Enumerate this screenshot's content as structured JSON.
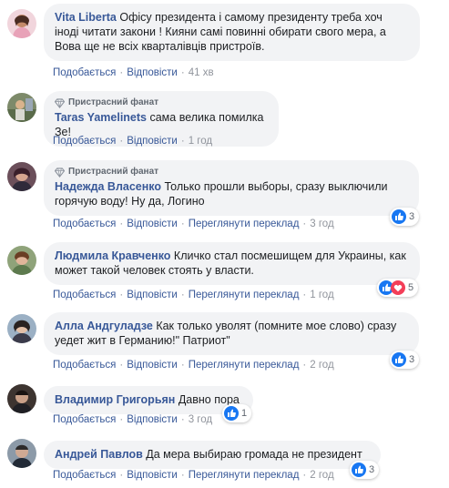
{
  "fan_badge": "Пристрасний фанат",
  "actions": {
    "like": "Подобається",
    "reply": "Відповісти",
    "see_translation": "Переглянути переклад"
  },
  "comments": [
    {
      "author": "Vita Liberta",
      "text": "Офісу президента і самому президенту треба хоч іноді читати закони ! Кияни самі повинні обирати свого мера, а Вова ще не всіх кварталівців пристроїв.",
      "time": "41 хв",
      "fan": false,
      "translate": false,
      "reactions": null
    },
    {
      "author": "Taras Yamelinets",
      "text": "сама велика помилка Зе!",
      "time": "1 год",
      "fan": true,
      "translate": false,
      "reactions": null
    },
    {
      "author": "Надежда Власенко",
      "text": "Только прошли выборы, сразу выключили горячую воду! Ну да, Логино",
      "time": "3 год",
      "fan": true,
      "translate": true,
      "reactions": {
        "types": [
          "like-icon"
        ],
        "count": "3"
      }
    },
    {
      "author": "Людмила Кравченко",
      "text": "Кличко стал посмешищем для Украины, как может такой человек стоять у власти.",
      "time": "1 год",
      "fan": false,
      "translate": true,
      "reactions": {
        "types": [
          "like-icon",
          "love-icon"
        ],
        "count": "5"
      }
    },
    {
      "author": "Алла Андгуладзе",
      "text": "Как только уволят (помните мое слово) сразу уедет жит в Германию!\" Патриот\"",
      "time": "2 год",
      "fan": false,
      "translate": true,
      "reactions": {
        "types": [
          "like-icon"
        ],
        "count": "3"
      }
    },
    {
      "author": "Владимир Григорьян",
      "text": "Давно пора",
      "time": "3 год",
      "fan": false,
      "translate": false,
      "reactions": {
        "types": [
          "like-icon"
        ],
        "count": "1"
      }
    },
    {
      "author": "Андрей Павлов",
      "text": "Да мера выбираю громада не президент",
      "time": "2 год",
      "fan": false,
      "translate": true,
      "reactions": {
        "types": [
          "like-icon"
        ],
        "count": "3"
      }
    }
  ],
  "colors": {
    "link": "#385898",
    "bubble": "#f2f3f5",
    "like": "#1877f2",
    "love": "#f33e58"
  }
}
